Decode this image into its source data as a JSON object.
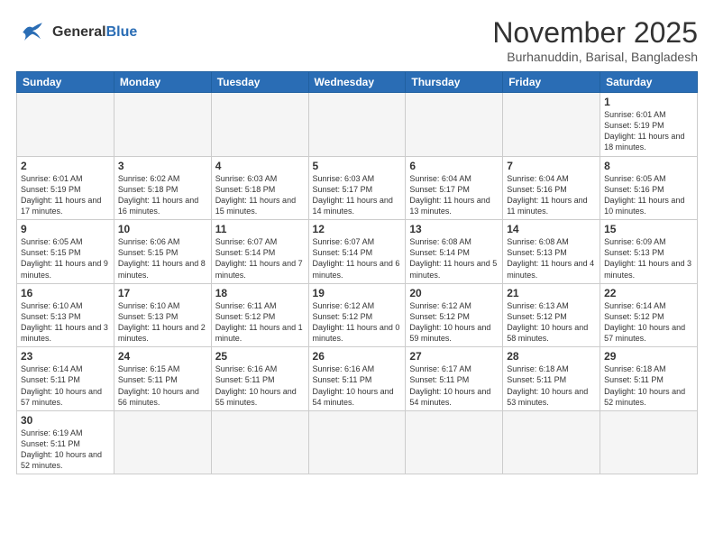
{
  "header": {
    "logo_line1": "General",
    "logo_line2": "Blue",
    "month_year": "November 2025",
    "location": "Burhanuddin, Barisal, Bangladesh"
  },
  "weekdays": [
    "Sunday",
    "Monday",
    "Tuesday",
    "Wednesday",
    "Thursday",
    "Friday",
    "Saturday"
  ],
  "weeks": [
    [
      {
        "day": "",
        "info": ""
      },
      {
        "day": "",
        "info": ""
      },
      {
        "day": "",
        "info": ""
      },
      {
        "day": "",
        "info": ""
      },
      {
        "day": "",
        "info": ""
      },
      {
        "day": "",
        "info": ""
      },
      {
        "day": "1",
        "info": "Sunrise: 6:01 AM\nSunset: 5:19 PM\nDaylight: 11 hours\nand 18 minutes."
      }
    ],
    [
      {
        "day": "2",
        "info": "Sunrise: 6:01 AM\nSunset: 5:19 PM\nDaylight: 11 hours\nand 17 minutes."
      },
      {
        "day": "3",
        "info": "Sunrise: 6:02 AM\nSunset: 5:18 PM\nDaylight: 11 hours\nand 16 minutes."
      },
      {
        "day": "4",
        "info": "Sunrise: 6:03 AM\nSunset: 5:18 PM\nDaylight: 11 hours\nand 15 minutes."
      },
      {
        "day": "5",
        "info": "Sunrise: 6:03 AM\nSunset: 5:17 PM\nDaylight: 11 hours\nand 14 minutes."
      },
      {
        "day": "6",
        "info": "Sunrise: 6:04 AM\nSunset: 5:17 PM\nDaylight: 11 hours\nand 13 minutes."
      },
      {
        "day": "7",
        "info": "Sunrise: 6:04 AM\nSunset: 5:16 PM\nDaylight: 11 hours\nand 11 minutes."
      },
      {
        "day": "8",
        "info": "Sunrise: 6:05 AM\nSunset: 5:16 PM\nDaylight: 11 hours\nand 10 minutes."
      }
    ],
    [
      {
        "day": "9",
        "info": "Sunrise: 6:05 AM\nSunset: 5:15 PM\nDaylight: 11 hours\nand 9 minutes."
      },
      {
        "day": "10",
        "info": "Sunrise: 6:06 AM\nSunset: 5:15 PM\nDaylight: 11 hours\nand 8 minutes."
      },
      {
        "day": "11",
        "info": "Sunrise: 6:07 AM\nSunset: 5:14 PM\nDaylight: 11 hours\nand 7 minutes."
      },
      {
        "day": "12",
        "info": "Sunrise: 6:07 AM\nSunset: 5:14 PM\nDaylight: 11 hours\nand 6 minutes."
      },
      {
        "day": "13",
        "info": "Sunrise: 6:08 AM\nSunset: 5:14 PM\nDaylight: 11 hours\nand 5 minutes."
      },
      {
        "day": "14",
        "info": "Sunrise: 6:08 AM\nSunset: 5:13 PM\nDaylight: 11 hours\nand 4 minutes."
      },
      {
        "day": "15",
        "info": "Sunrise: 6:09 AM\nSunset: 5:13 PM\nDaylight: 11 hours\nand 3 minutes."
      }
    ],
    [
      {
        "day": "16",
        "info": "Sunrise: 6:10 AM\nSunset: 5:13 PM\nDaylight: 11 hours\nand 3 minutes."
      },
      {
        "day": "17",
        "info": "Sunrise: 6:10 AM\nSunset: 5:13 PM\nDaylight: 11 hours\nand 2 minutes."
      },
      {
        "day": "18",
        "info": "Sunrise: 6:11 AM\nSunset: 5:12 PM\nDaylight: 11 hours\nand 1 minute."
      },
      {
        "day": "19",
        "info": "Sunrise: 6:12 AM\nSunset: 5:12 PM\nDaylight: 11 hours\nand 0 minutes."
      },
      {
        "day": "20",
        "info": "Sunrise: 6:12 AM\nSunset: 5:12 PM\nDaylight: 10 hours\nand 59 minutes."
      },
      {
        "day": "21",
        "info": "Sunrise: 6:13 AM\nSunset: 5:12 PM\nDaylight: 10 hours\nand 58 minutes."
      },
      {
        "day": "22",
        "info": "Sunrise: 6:14 AM\nSunset: 5:12 PM\nDaylight: 10 hours\nand 57 minutes."
      }
    ],
    [
      {
        "day": "23",
        "info": "Sunrise: 6:14 AM\nSunset: 5:11 PM\nDaylight: 10 hours\nand 57 minutes."
      },
      {
        "day": "24",
        "info": "Sunrise: 6:15 AM\nSunset: 5:11 PM\nDaylight: 10 hours\nand 56 minutes."
      },
      {
        "day": "25",
        "info": "Sunrise: 6:16 AM\nSunset: 5:11 PM\nDaylight: 10 hours\nand 55 minutes."
      },
      {
        "day": "26",
        "info": "Sunrise: 6:16 AM\nSunset: 5:11 PM\nDaylight: 10 hours\nand 54 minutes."
      },
      {
        "day": "27",
        "info": "Sunrise: 6:17 AM\nSunset: 5:11 PM\nDaylight: 10 hours\nand 54 minutes."
      },
      {
        "day": "28",
        "info": "Sunrise: 6:18 AM\nSunset: 5:11 PM\nDaylight: 10 hours\nand 53 minutes."
      },
      {
        "day": "29",
        "info": "Sunrise: 6:18 AM\nSunset: 5:11 PM\nDaylight: 10 hours\nand 52 minutes."
      }
    ],
    [
      {
        "day": "30",
        "info": "Sunrise: 6:19 AM\nSunset: 5:11 PM\nDaylight: 10 hours\nand 52 minutes."
      },
      {
        "day": "",
        "info": ""
      },
      {
        "day": "",
        "info": ""
      },
      {
        "day": "",
        "info": ""
      },
      {
        "day": "",
        "info": ""
      },
      {
        "day": "",
        "info": ""
      },
      {
        "day": "",
        "info": ""
      }
    ]
  ]
}
